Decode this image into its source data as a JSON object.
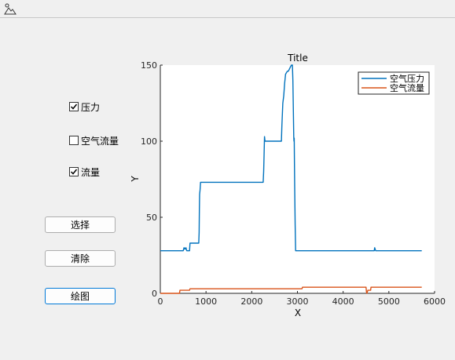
{
  "toolbar": {
    "icon": "image-mountain-icon"
  },
  "controls": {
    "checkboxes": [
      {
        "label": "压力",
        "checked": true
      },
      {
        "label": "空气流量",
        "checked": false
      },
      {
        "label": "流量",
        "checked": true
      }
    ],
    "buttons": {
      "select_label": "选择",
      "clear_label": "清除",
      "plot_label": "绘图"
    }
  },
  "chart_data": {
    "type": "line",
    "title": "Title",
    "xlabel": "X",
    "ylabel": "Y",
    "xlim": [
      0,
      6000
    ],
    "ylim": [
      0,
      150
    ],
    "xticks": [
      0,
      1000,
      2000,
      3000,
      4000,
      5000,
      6000
    ],
    "yticks": [
      0,
      50,
      100,
      150
    ],
    "grid": false,
    "legend_position": "top-right",
    "series": [
      {
        "name": "空气压力",
        "color": "#0072bd",
        "x": [
          0,
          500,
          520,
          540,
          560,
          580,
          600,
          640,
          650,
          660,
          840,
          850,
          855,
          860,
          870,
          880,
          900,
          2250,
          2260,
          2270,
          2280,
          2290,
          2300,
          2650,
          2660,
          2680,
          2700,
          2720,
          2740,
          2760,
          2780,
          2800,
          2850,
          2870,
          2890,
          2900,
          2910,
          2920,
          2925,
          2930,
          2935,
          2940,
          2950,
          2960,
          2970,
          4680,
          4690,
          4700,
          4710,
          5720
        ],
        "y": [
          28,
          28,
          30,
          29,
          30,
          28,
          28,
          28,
          33,
          33,
          33,
          40,
          55,
          65,
          68,
          73,
          73,
          73,
          80,
          90,
          103,
          100,
          100,
          100,
          110,
          125,
          130,
          138,
          144,
          145,
          146,
          146,
          149,
          150,
          150,
          140,
          120,
          103,
          100,
          102,
          85,
          70,
          45,
          28,
          28,
          28,
          30,
          29,
          28,
          28
        ]
      },
      {
        "name": "空气流量",
        "color": "#d95319",
        "x": [
          0,
          420,
          430,
          440,
          450,
          640,
          650,
          660,
          3100,
          3110,
          3120,
          4500,
          4510,
          4520,
          4540,
          4560,
          4580,
          4600,
          4610,
          4620,
          5720
        ],
        "y": [
          0,
          0,
          2,
          2,
          2,
          2,
          3,
          3,
          3,
          4,
          4,
          4,
          1,
          0,
          2,
          2,
          2,
          2,
          4,
          4,
          4
        ]
      }
    ]
  }
}
